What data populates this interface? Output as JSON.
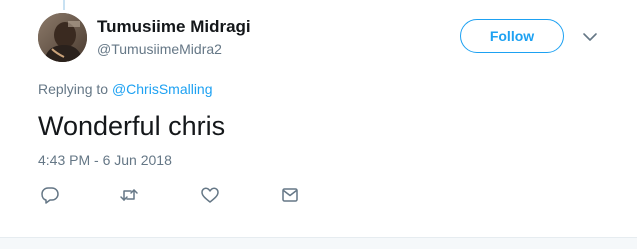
{
  "tweet": {
    "author": {
      "name": "Tumusiime Midragi",
      "handle": "@TumusiimeMidra2"
    },
    "follow_label": "Follow",
    "replying_prefix": "Replying to",
    "replying_to": "@ChrisSmalling",
    "text": "Wonderful chris",
    "timestamp": "4:43 PM - 6 Jun 2018",
    "actions": {
      "icons": [
        "reply-icon",
        "retweet-icon",
        "like-icon",
        "direct-message-icon"
      ]
    }
  },
  "colors": {
    "accent": "#1da1f2",
    "muted_text": "#657786",
    "primary_text": "#14171a",
    "thread_line": "#c8e1f2",
    "footer_bg": "#f5f8fa"
  }
}
